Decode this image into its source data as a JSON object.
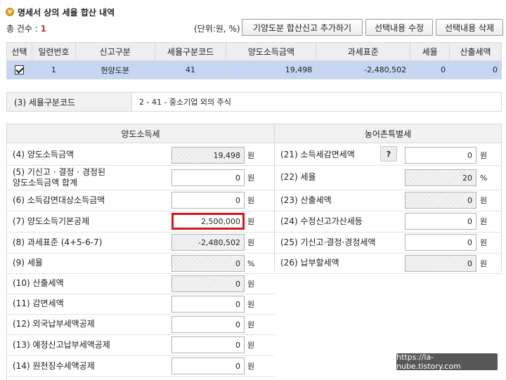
{
  "header": {
    "bullet_glyph": "v",
    "title": "명세서 상의 세율 합산 내역",
    "count_label": "총 건수 : ",
    "count_value": "1",
    "unit_text": "(단위:원, %)"
  },
  "toolbar": {
    "add_label": "기양도분 합산신고 추가하기",
    "edit_label": "선택내용 수정",
    "delete_label": "선택내용 삭제"
  },
  "list": {
    "columns": [
      "선택",
      "일련번호",
      "신고구분",
      "세율구분코드",
      "양도소득금액",
      "과세표준",
      "세율",
      "산출세액"
    ],
    "rows": [
      {
        "checked": true,
        "serial": "1",
        "type": "현양도분",
        "rate_code": "41",
        "income": "19,498",
        "tax_base": "-2,480,502",
        "rate": "0",
        "calc_tax": "0"
      }
    ]
  },
  "code_section": {
    "label": "(3) 세율구분코드",
    "value": "2 - 41 - 중소기업 외의 주식"
  },
  "left_section": {
    "title": "양도소득세",
    "rows": [
      {
        "label": "(4) 양도소득금액",
        "value": "19,498",
        "unit": "원"
      },
      {
        "label": "(5) 기신고 · 결정 · 경정된\n양도소득금액 합계",
        "value": "0",
        "unit": "원"
      },
      {
        "label": "(6) 소득감면대상소득금액",
        "value": "0",
        "unit": "원"
      },
      {
        "label": "(7) 양도소득기본공제",
        "value": "2,500,000",
        "unit": "원"
      },
      {
        "label": "(8) 과세표준 (4+5-6-7)",
        "value": "-2,480,502",
        "unit": "원"
      },
      {
        "label": "(9) 세율",
        "value": "0",
        "unit": "%"
      },
      {
        "label": "(10) 산출세액",
        "value": "0",
        "unit": "원"
      },
      {
        "label": "(11) 감면세액",
        "value": "0",
        "unit": "원"
      },
      {
        "label": "(12) 외국납부세액공제",
        "value": "0",
        "unit": "원"
      },
      {
        "label": "(13) 예정신고납부세액공제",
        "value": "0",
        "unit": "원"
      },
      {
        "label": "(14) 원천징수세액공제",
        "value": "0",
        "unit": "원"
      }
    ]
  },
  "right_section": {
    "title": "농어촌특별세",
    "help_label": "?",
    "rows": [
      {
        "label": "(21) 소득세감면세액",
        "value": "0",
        "unit": "원"
      },
      {
        "label": "(22) 세율",
        "value": "20",
        "unit": "%"
      },
      {
        "label": "(23) 산출세액",
        "value": "0",
        "unit": "원"
      },
      {
        "label": "(24) 수정신고가산세등",
        "value": "0",
        "unit": "원"
      },
      {
        "label": "(25) 기신고·결정·경정세액",
        "value": "0",
        "unit": "원"
      },
      {
        "label": "(26) 납부할세액",
        "value": "0",
        "unit": "원"
      }
    ]
  },
  "watermark": "https://la-nube.tistory.com"
}
